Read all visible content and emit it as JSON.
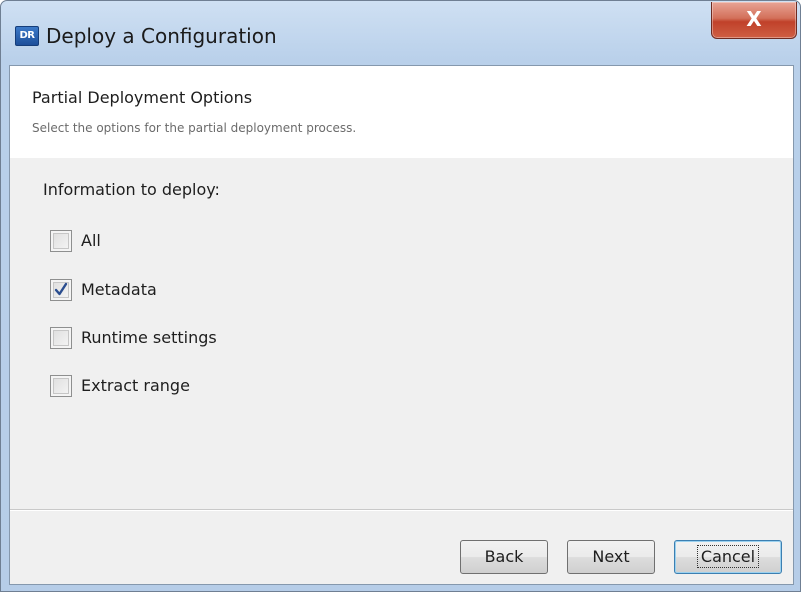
{
  "window": {
    "app_icon_text": "DR",
    "title": "Deploy a Configuration",
    "close_label": "X"
  },
  "header": {
    "title": "Partial Deployment Options",
    "subtitle": "Select the options for the partial deployment process."
  },
  "section": {
    "label": "Information to deploy:"
  },
  "options": [
    {
      "label": "All",
      "checked": false
    },
    {
      "label": "Metadata",
      "checked": true
    },
    {
      "label": "Runtime settings",
      "checked": false
    },
    {
      "label": "Extract range",
      "checked": false
    }
  ],
  "buttons": {
    "back": "Back",
    "next": "Next",
    "cancel": "Cancel"
  },
  "colors": {
    "checkmark": "#2a4d8f",
    "close_button": "#c0412a"
  }
}
